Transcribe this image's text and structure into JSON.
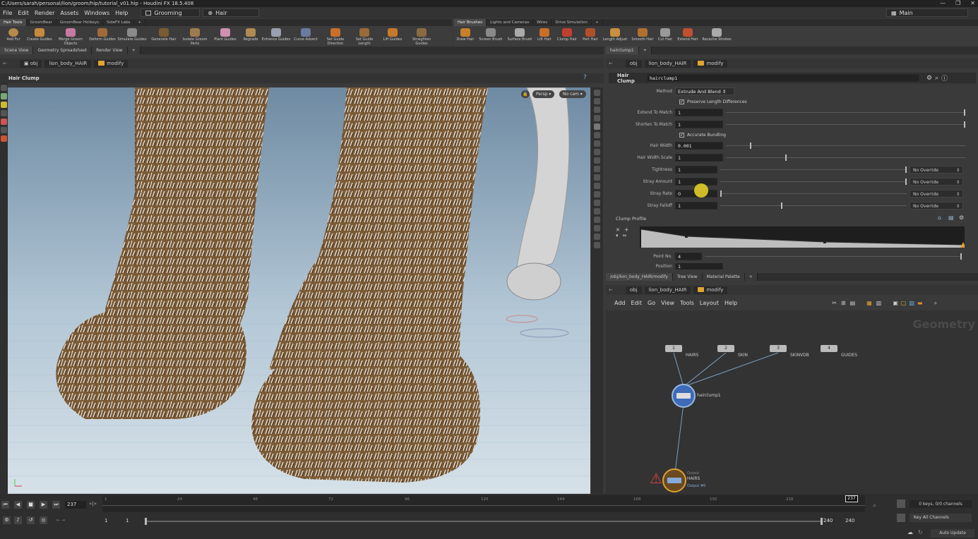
{
  "window": {
    "title": "C:/Users/sarah/personal/lion/groom/hip/tutorial_v01.hip - Houdini FX 18.5.408",
    "controls": [
      "—",
      "❐",
      "✕"
    ]
  },
  "menubar": {
    "items": [
      "File",
      "Edit",
      "Render",
      "Assets",
      "Windows",
      "Help"
    ],
    "desktop": "Grooming",
    "context": "Hair",
    "main": "Main"
  },
  "shelf_left": {
    "tabs": [
      "Hair Tools",
      "GroomBear",
      "GroomBear Hotkeys",
      "SideFX Labs"
    ],
    "tools": [
      "Add Fur",
      "Create Guides",
      "Merge Groom Objects",
      "Deform Guides",
      "Simulate Guides",
      "Generate Hair",
      "Isolate Groom Parts",
      "Plant Guides",
      "Regrade",
      "Enhance Guides",
      "Curve Advect",
      "Set Guide Direction",
      "Set Guide Length",
      "Lift Guides",
      "Straighten Guides"
    ]
  },
  "shelf_right": {
    "tabs": [
      "Hair Brushes",
      "Lights and Cameras",
      "Wires",
      "Drive Simulation"
    ],
    "tools": [
      "Draw Hair",
      "Screen Brush",
      "Surface Brush",
      "Lift Hair",
      "Clump Hair",
      "Part Hair",
      "Length Adjust",
      "Smooth Hair",
      "Cut Hair",
      "Extend Hair",
      "Recache Strokes"
    ]
  },
  "viewer": {
    "tabs": [
      "Scene View",
      "Geometry Spreadsheet",
      "Render View"
    ],
    "path": [
      "obj",
      "lion_body_HAIR",
      "modify"
    ],
    "tool_title": "Hair Clump",
    "persp": "Persp",
    "cam": "No cam"
  },
  "params": {
    "tab": "hairclump1",
    "path": [
      "obj",
      "lion_body_HAIR",
      "modify"
    ],
    "node_type": "Hair Clump",
    "node_name": "hairclump1",
    "method_label": "Method",
    "method_value": "Extrude And Blend",
    "preserve": "Preserve Length Differences",
    "extend_label": "Extend To Match",
    "extend_value": "1",
    "shorten_label": "Shorten To Match",
    "shorten_value": "1",
    "bundling": "Accurate Bundling",
    "hairwidth_label": "Hair Width",
    "hairwidth_value": "0.001",
    "hairwidthscale_label": "Hair Width Scale",
    "hairwidthscale_value": "1",
    "tightness_label": "Tightness",
    "tightness_value": "1",
    "stray_label": "Stray Amount",
    "stray_value": "1",
    "strayrate_label": "Stray Rate",
    "strayrate_value": "0",
    "strayfalloff_label": "Stray Falloff",
    "strayfalloff_value": "1",
    "override": "No Override",
    "clump_profile": "Clump Profile",
    "pointno_label": "Point No.",
    "pointno_value": "4",
    "position_label": "Position",
    "position_value": "1"
  },
  "network": {
    "tabs": [
      "/obj/lion_body_HAIR/modify",
      "Tree View",
      "Material Palette"
    ],
    "path": [
      "obj",
      "lion_body_HAIR",
      "modify"
    ],
    "menu": [
      "Add",
      "Edit",
      "Go",
      "View",
      "Tools",
      "Layout",
      "Help"
    ],
    "watermark": "Geometry",
    "inputs": [
      {
        "num": "1",
        "label": "HAIRS"
      },
      {
        "num": "2",
        "label": "SKIN"
      },
      {
        "num": "3",
        "label": "SKINVDB"
      },
      {
        "num": "4",
        "label": "GUIDES"
      }
    ],
    "clump_node": "hairclump1",
    "output_label": "Output",
    "output_name": "HAIRS",
    "output_sub": "Output #0"
  },
  "timeline": {
    "frame": "237",
    "ticks": [
      "1",
      "24",
      "48",
      "72",
      "96",
      "120",
      "144",
      "168",
      "192",
      "216"
    ],
    "marker": "237",
    "start": "1",
    "start2": "1",
    "end": "240",
    "end2": "240",
    "keys": "0 keys, 0/0 channels",
    "keyall": "Key All Channels",
    "autoupdate": "Auto Update"
  }
}
